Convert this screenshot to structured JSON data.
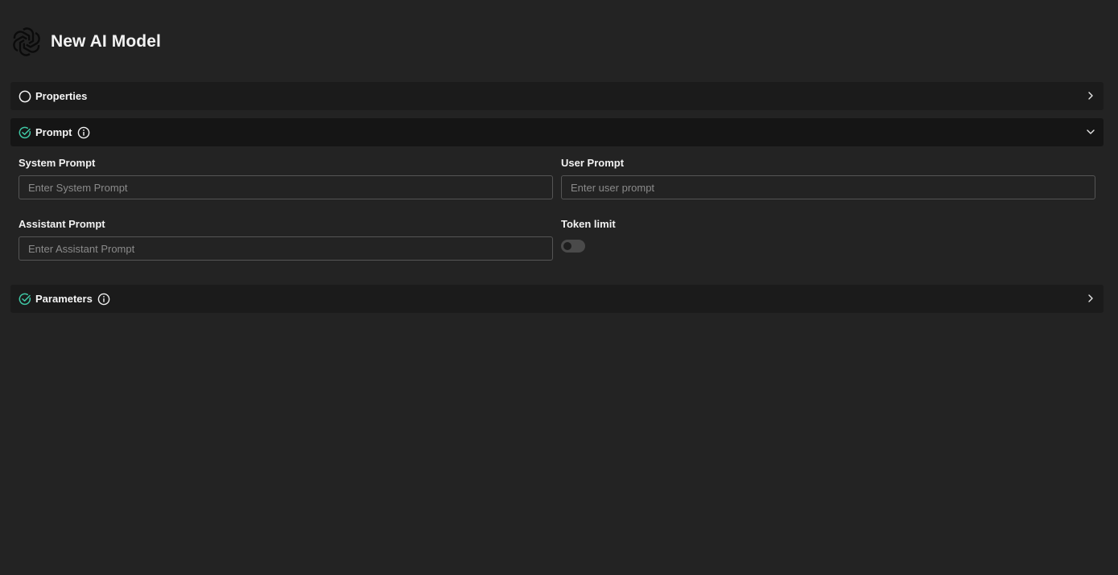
{
  "header": {
    "title": "New AI Model",
    "logo_icon": "openai-knot-icon"
  },
  "sections": [
    {
      "id": "properties",
      "title": "Properties",
      "status": "incomplete",
      "expanded": false,
      "has_info": false
    },
    {
      "id": "prompt",
      "title": "Prompt",
      "status": "complete",
      "expanded": true,
      "has_info": true
    },
    {
      "id": "parameters",
      "title": "Parameters",
      "status": "complete",
      "expanded": false,
      "has_info": true
    }
  ],
  "prompt_form": {
    "system_prompt": {
      "label": "System Prompt",
      "value": "",
      "placeholder": "Enter System Prompt"
    },
    "user_prompt": {
      "label": "User Prompt",
      "value": "",
      "placeholder": "Enter user prompt"
    },
    "assistant_prompt": {
      "label": "Assistant Prompt",
      "value": "",
      "placeholder": "Enter Assistant Prompt"
    },
    "token_limit": {
      "label": "Token limit",
      "enabled": false
    }
  },
  "colors": {
    "background": "#232323",
    "section_header": "#1b1b1b",
    "section_header_open": "#151515",
    "check_accent": "#3fc7a4",
    "input_border": "#555555"
  }
}
